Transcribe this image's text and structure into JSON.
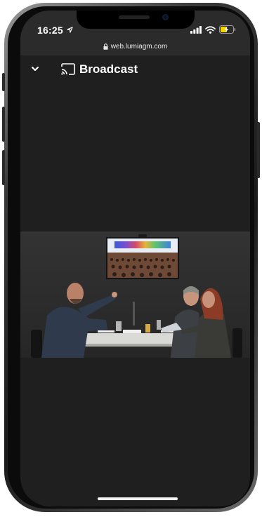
{
  "status_bar": {
    "time": "16:25",
    "url": "web.lumiagm.com"
  },
  "header": {
    "title": "Broadcast"
  },
  "icons": {
    "location": "location-arrow-icon",
    "signal": "cellular-signal-icon",
    "wifi": "wifi-icon",
    "battery": "battery-charging-icon",
    "lock": "lock-icon",
    "collapse": "chevron-down-icon",
    "cast": "cast-icon"
  },
  "colors": {
    "background": "#1f1f1f",
    "chrome": "#2b2b2b",
    "battery": "#f5d400"
  }
}
